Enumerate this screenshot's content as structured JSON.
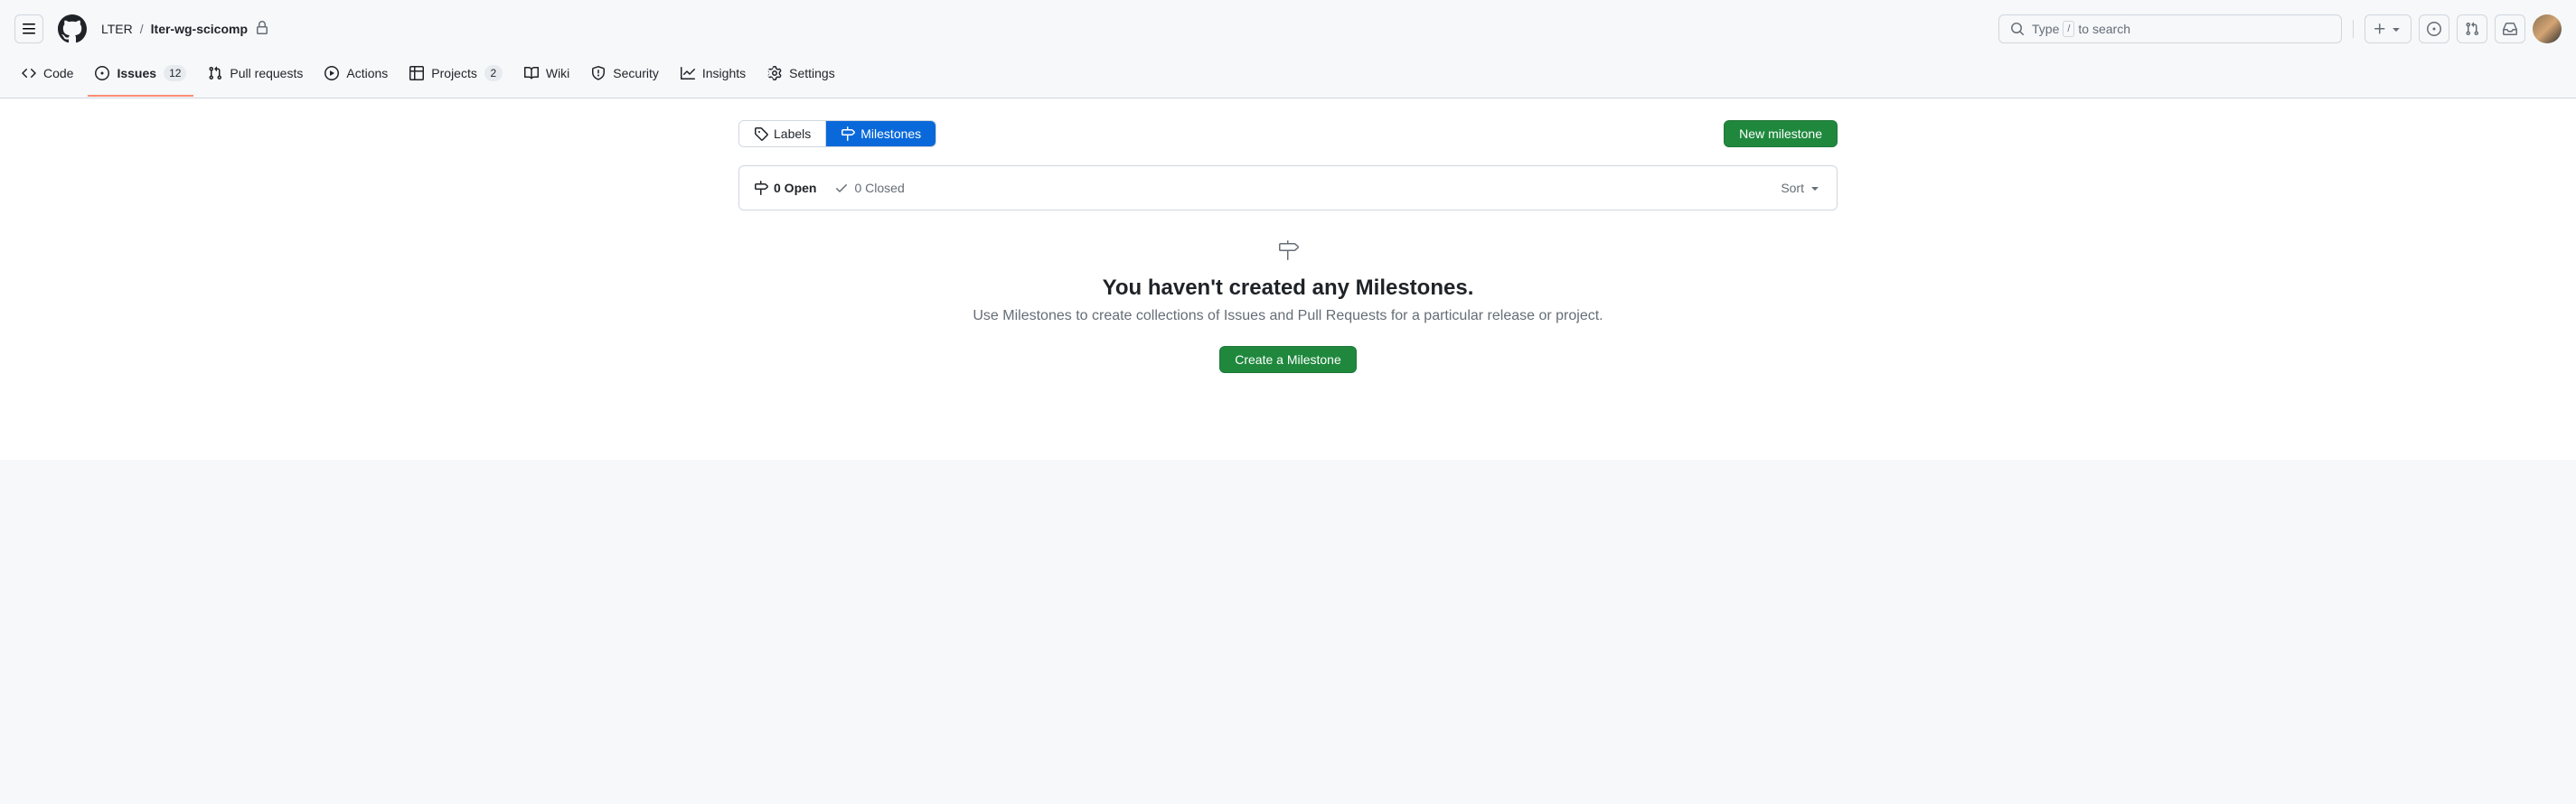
{
  "breadcrumb": {
    "owner": "LTER",
    "repo": "lter-wg-scicomp"
  },
  "search": {
    "type_text": "Type",
    "kbd": "/",
    "to_search": "to search"
  },
  "nav": {
    "code": "Code",
    "issues": "Issues",
    "issues_count": "12",
    "pull_requests": "Pull requests",
    "actions": "Actions",
    "projects": "Projects",
    "projects_count": "2",
    "wiki": "Wiki",
    "security": "Security",
    "insights": "Insights",
    "settings": "Settings"
  },
  "toolbar": {
    "labels": "Labels",
    "milestones": "Milestones",
    "new_milestone": "New milestone"
  },
  "filters": {
    "open": "0 Open",
    "closed": "0 Closed",
    "sort": "Sort"
  },
  "blankslate": {
    "title": "You haven't created any Milestones.",
    "description": "Use Milestones to create collections of Issues and Pull Requests for a particular release or project.",
    "button": "Create a Milestone"
  }
}
